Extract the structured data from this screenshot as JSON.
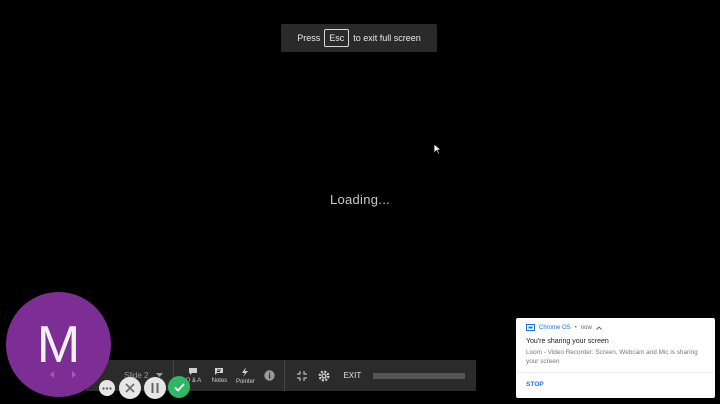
{
  "fullscreen_hint": {
    "prefix": "Press",
    "key": "Esc",
    "suffix": "to exit full screen"
  },
  "loading_text": "Loading...",
  "toolbar": {
    "slide_label": "Slide 2",
    "tools": [
      {
        "label": "Q & A",
        "icon": "chat-icon"
      },
      {
        "label": "Notes",
        "icon": "notes-icon"
      },
      {
        "label": "Pointer",
        "icon": "pointer-icon"
      }
    ],
    "exit_label": "EXIT"
  },
  "avatar": {
    "initial": "M",
    "color": "#7d2e94"
  },
  "notification": {
    "app": "Chrome OS",
    "time": "now",
    "title": "You're sharing your screen",
    "body": "Loom - Video Recorder: Screen, Webcam and Mic is sharing your screen",
    "action": "STOP"
  }
}
